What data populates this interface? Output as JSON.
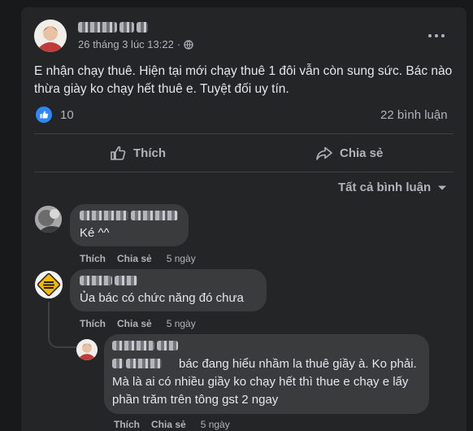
{
  "post": {
    "date": "26 tháng 3 lúc 13:22",
    "dot": "·",
    "body": "E nhận chạy thuê. Hiện tại mới chạy thuê 1 đôi vẫn còn sung sức. Bác nào thừa giày ko chạy hết thuê e. Tuyệt đối uy tín.",
    "reaction_count": "10",
    "comment_count": "22 bình luận",
    "more_icon": "ellipsis-icon",
    "privacy_icon": "globe-icon"
  },
  "actions": {
    "like_label": "Thích",
    "share_label": "Chia sẻ"
  },
  "filter": {
    "label": "Tất cả bình luận",
    "icon": "caret-down-icon"
  },
  "comments": [
    {
      "text": "Ké ^^",
      "like": "Thích",
      "share": "Chia sẻ",
      "time": "5 ngày"
    },
    {
      "text": "Ủa bác có chức năng đó chưa",
      "like": "Thích",
      "share": "Chia sẻ",
      "time": "5 ngày"
    },
    {
      "text": "bác đang hiểu nhầm la thuê giầy à. Ko phải. Mà là ai có nhiều giầy ko chạy hết thì thue e chạy e lấy phần trăm trên tông gst 2 ngay",
      "like": "Thích",
      "share": "Chia sẻ",
      "time": "5 ngày"
    }
  ],
  "colors": {
    "background": "#18191a",
    "card": "#242526",
    "bubble": "#3a3b3c",
    "like_blue": "#2d88ff"
  }
}
